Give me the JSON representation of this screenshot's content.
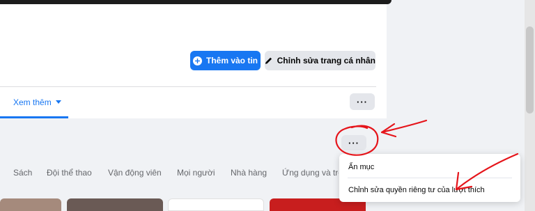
{
  "actions": {
    "add_story_label": "Thêm vào tin",
    "edit_profile_label": "Chỉnh sửa trang cá nhân"
  },
  "tabs": {
    "see_more_label": "Xem thêm"
  },
  "more_button_label": "···",
  "likes_more_button_label": "···",
  "categories": [
    "Sách",
    "Đội thể thao",
    "Vận động viên",
    "Mọi người",
    "Nhà hàng",
    "Ứng dụng và trò"
  ],
  "dropdown": {
    "items": [
      "Ẩn mục",
      "Chỉnh sửa quyền riêng tư của lượt thích"
    ]
  },
  "colors": {
    "accent": "#1877f2",
    "annotation": "#e5141a"
  },
  "icons": {
    "add_story": "plus-circle-icon",
    "edit_profile": "pencil-icon",
    "see_more": "caret-down-icon"
  }
}
